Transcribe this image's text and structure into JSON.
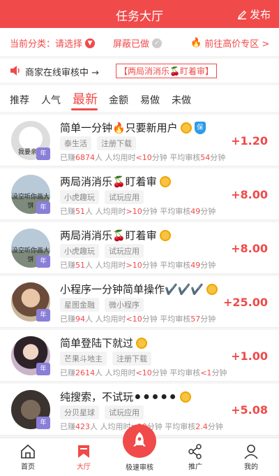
{
  "header": {
    "title": "任务大厅",
    "publish_label": "发布"
  },
  "filter": {
    "category_label": "当前分类：请选择",
    "blocked_label": "屏蔽已做",
    "premium_label": "前往高价专区 >"
  },
  "notice": {
    "text": "商家在线审核中 →",
    "tag": "【两局消消乐🍒盯着审】"
  },
  "tabs": [
    "推荐",
    "人气",
    "最新",
    "金额",
    "易做",
    "未做"
  ],
  "active_tab": "最新",
  "tasks": [
    {
      "title": "简单一分钟🔥只要新用户",
      "tags": [
        "泰生活",
        "注册下载"
      ],
      "earned": "6874",
      "avg_time": "<10",
      "avg_review": "54",
      "reward": "+1.20",
      "caption": "我要亲亲"
    },
    {
      "title": "两局消消乐🍒盯着审",
      "tags": [
        "小虎趣玩",
        "试玩应用"
      ],
      "earned": "51",
      "avg_time": ">10",
      "avg_review": "49",
      "reward": "+8.00",
      "caption": "没空听你画大饼"
    },
    {
      "title": "两局消消乐🍒盯着审",
      "tags": [
        "小虎趣玩",
        "试玩应用"
      ],
      "earned": "51",
      "avg_time": ">10",
      "avg_review": "49",
      "reward": "+8.00",
      "caption": "没空听你画大饼"
    },
    {
      "title": "小程序一分钟简单操作✔️✔️✔️",
      "tags": [
        "星图金融",
        "微小程序"
      ],
      "earned": "94",
      "avg_time": "<10",
      "avg_review": "57",
      "reward": "+25.00",
      "caption": ""
    },
    {
      "title": "简单登陆下就过",
      "tags": [
        "芒果斗地主",
        "注册下载"
      ],
      "earned": "2614",
      "avg_time": "<10",
      "avg_review": "<1",
      "reward": "+1.00",
      "caption": ""
    },
    {
      "title": "纯搜索，不试玩⚫⚫⚫⚫⚫",
      "tags": [
        "分贝星球",
        "试玩应用"
      ],
      "earned": "423",
      "avg_time": ">10",
      "avg_review": "2.4",
      "reward": "+5.08",
      "caption": ""
    }
  ],
  "labels": {
    "earned_prefix": "已赚",
    "earned_suffix": "人",
    "avg_time_prefix": "人均用时",
    "avg_time_suffix": "分钟",
    "avg_review_prefix": "平均审核",
    "avg_review_suffix": "分钟",
    "year_badge": "年"
  },
  "bottom_nav": {
    "home": "首页",
    "hall": "大厅",
    "fast_review": "极速审核",
    "promote": "推广",
    "mine": "我的"
  }
}
